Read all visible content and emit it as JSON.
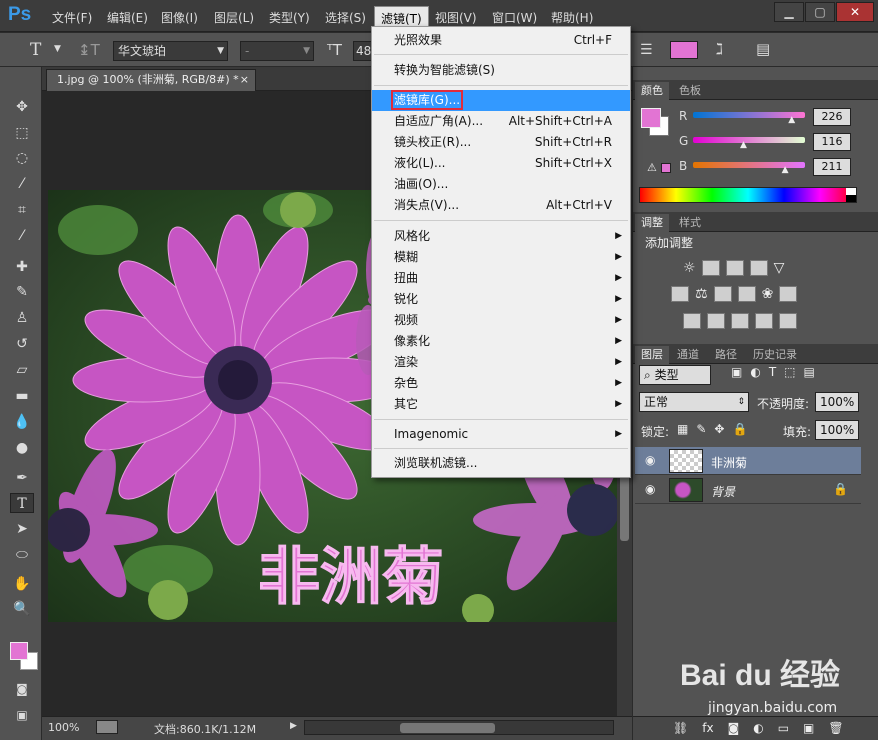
{
  "app": {
    "logo": "Ps"
  },
  "menubar": {
    "items": [
      "文件(F)",
      "编辑(E)",
      "图像(I)",
      "图层(L)",
      "类型(Y)",
      "选择(S)",
      "滤镜(T)",
      "视图(V)",
      "窗口(W)",
      "帮助(H)"
    ],
    "active_index": 6
  },
  "window_controls": {
    "minimize": "▁",
    "maximize": "▢",
    "close": "✕"
  },
  "options_bar": {
    "font_family": "华文琥珀",
    "font_style": "-",
    "font_size": "48"
  },
  "document": {
    "tab_title": "1.jpg @ 100% (非洲菊, RGB/8#) *",
    "tab_close": "×",
    "overlay_text": "非洲菊"
  },
  "status": {
    "zoom": "100%",
    "doc_info": "文档:860.1K/1.12M"
  },
  "filter_menu": {
    "groups": [
      [
        {
          "label": "光照效果",
          "shortcut": "Ctrl+F"
        }
      ],
      [
        {
          "label": "转换为智能滤镜(S)",
          "shortcut": ""
        }
      ],
      [
        {
          "label": "滤镜库(G)...",
          "shortcut": "",
          "highlighted": true
        },
        {
          "label": "自适应广角(A)...",
          "shortcut": "Alt+Shift+Ctrl+A"
        },
        {
          "label": "镜头校正(R)...",
          "shortcut": "Shift+Ctrl+R"
        },
        {
          "label": "液化(L)...",
          "shortcut": "Shift+Ctrl+X"
        },
        {
          "label": "油画(O)...",
          "shortcut": ""
        },
        {
          "label": "消失点(V)...",
          "shortcut": "Alt+Ctrl+V"
        }
      ],
      [
        {
          "label": "风格化",
          "submenu": true
        },
        {
          "label": "模糊",
          "submenu": true
        },
        {
          "label": "扭曲",
          "submenu": true
        },
        {
          "label": "锐化",
          "submenu": true
        },
        {
          "label": "视频",
          "submenu": true
        },
        {
          "label": "像素化",
          "submenu": true
        },
        {
          "label": "渲染",
          "submenu": true
        },
        {
          "label": "杂色",
          "submenu": true
        },
        {
          "label": "其它",
          "submenu": true
        }
      ],
      [
        {
          "label": "Imagenomic",
          "submenu": true
        }
      ],
      [
        {
          "label": "浏览联机滤镜...",
          "shortcut": ""
        }
      ]
    ]
  },
  "color_panel": {
    "tabs": [
      "颜色",
      "色板"
    ],
    "channels": [
      {
        "name": "R",
        "value": "226",
        "fraction": 0.886
      },
      {
        "name": "G",
        "value": "116",
        "fraction": 0.455
      },
      {
        "name": "B",
        "value": "211",
        "fraction": 0.827
      }
    ],
    "foreground": "#e274d3"
  },
  "adjust_panel": {
    "tabs": [
      "调整",
      "样式"
    ],
    "title": "添加调整"
  },
  "layers_panel": {
    "tabs": [
      "图层",
      "通道",
      "路径",
      "历史记录"
    ],
    "filter_label": "类型",
    "blend_mode": "正常",
    "opacity_label": "不透明度:",
    "opacity_value": "100%",
    "lock_label": "锁定:",
    "fill_label": "填充:",
    "fill_value": "100%",
    "layers": [
      {
        "name": "非洲菊",
        "selected": true,
        "type": "text"
      },
      {
        "name": "背景",
        "selected": false,
        "type": "image",
        "locked": true
      }
    ]
  },
  "watermark": {
    "brand": "Bai du 经验",
    "url": "jingyan.baidu.com"
  }
}
